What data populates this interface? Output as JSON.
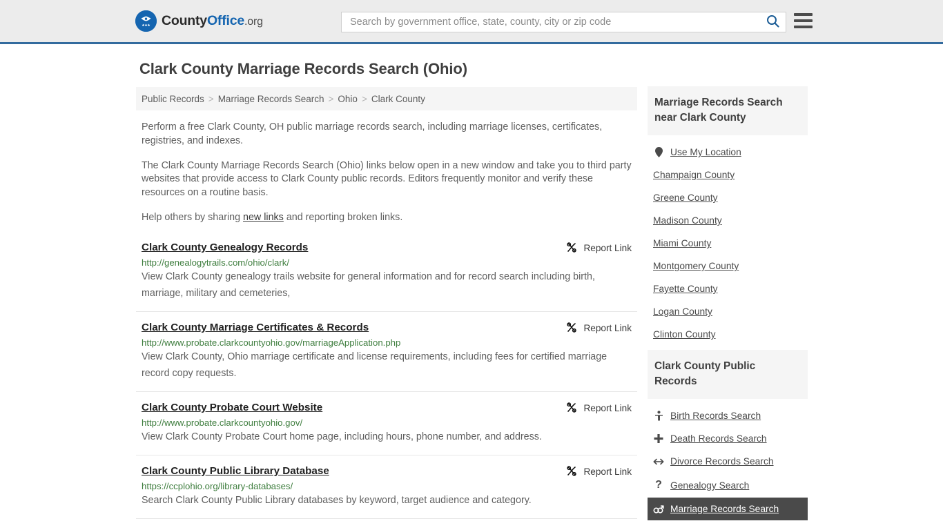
{
  "header": {
    "logo": {
      "part1": "County",
      "part2": "Office",
      "part3": ".org",
      "icon": "eagle-seal-icon"
    },
    "search": {
      "placeholder": "Search by government office, state, county, city or zip code",
      "value": "",
      "icon": "search-icon"
    },
    "menu_icon": "hamburger-menu-icon"
  },
  "page": {
    "title": "Clark County Marriage Records Search (Ohio)"
  },
  "breadcrumb": {
    "separator": ">",
    "items": [
      {
        "label": "Public Records"
      },
      {
        "label": "Marriage Records Search"
      },
      {
        "label": "Ohio"
      },
      {
        "label": "Clark County"
      }
    ]
  },
  "intro": {
    "p1": "Perform a free Clark County, OH public marriage records search, including marriage licenses, certificates, registries, and indexes.",
    "p2": "The Clark County Marriage Records Search (Ohio) links below open in a new window and take you to third party websites that provide access to Clark County public records. Editors frequently monitor and verify these resources on a routine basis.",
    "p3_before": "Help others by sharing ",
    "p3_link": "new links",
    "p3_after": " and reporting broken links."
  },
  "results": {
    "report_label": "Report Link",
    "report_icon": "broken-link-icon",
    "items": [
      {
        "title": "Clark County Genealogy Records",
        "url": "http://genealogytrails.com/ohio/clark/",
        "description": "View Clark County genealogy trails website for general information and for record search including birth, marriage, military and cemeteries,"
      },
      {
        "title": "Clark County Marriage Certificates & Records",
        "url": "http://www.probate.clarkcountyohio.gov/marriageApplication.php",
        "description": "View Clark County, Ohio marriage certificate and license requirements, including fees for certified marriage record copy requests."
      },
      {
        "title": "Clark County Probate Court Website",
        "url": "http://www.probate.clarkcountyohio.gov/",
        "description": "View Clark County Probate Court home page, including hours, phone number, and address."
      },
      {
        "title": "Clark County Public Library Database",
        "url": "https://ccplohio.org/library-databases/",
        "description": "Search Clark County Public Library databases by keyword, target audience and category."
      }
    ]
  },
  "sidebar": {
    "nearby": {
      "heading": "Marriage Records Search near Clark County",
      "items": [
        {
          "label": "Use My Location",
          "icon": "map-pin-icon",
          "has_icon": true
        },
        {
          "label": "Champaign County",
          "icon": "",
          "has_icon": false
        },
        {
          "label": "Greene County",
          "icon": "",
          "has_icon": false
        },
        {
          "label": "Madison County",
          "icon": "",
          "has_icon": false
        },
        {
          "label": "Miami County",
          "icon": "",
          "has_icon": false
        },
        {
          "label": "Montgomery County",
          "icon": "",
          "has_icon": false
        },
        {
          "label": "Fayette County",
          "icon": "",
          "has_icon": false
        },
        {
          "label": "Logan County",
          "icon": "",
          "has_icon": false
        },
        {
          "label": "Clinton County",
          "icon": "",
          "has_icon": false
        }
      ]
    },
    "public_records": {
      "heading": "Clark County Public Records",
      "items": [
        {
          "label": "Birth Records Search",
          "icon": "baby-icon",
          "glyph": "Ŧ",
          "active": false
        },
        {
          "label": "Death Records Search",
          "icon": "cross-icon",
          "glyph": "✚",
          "active": false
        },
        {
          "label": "Divorce Records Search",
          "icon": "left-right-arrow-icon",
          "glyph": "↔",
          "active": false
        },
        {
          "label": "Genealogy Search",
          "icon": "question-mark-icon",
          "glyph": "?",
          "active": false
        },
        {
          "label": "Marriage Records Search",
          "icon": "male-female-icon",
          "glyph": "⚥",
          "active": true
        }
      ]
    }
  },
  "colors": {
    "brand_blue": "#1565b0",
    "header_border": "#336b9e",
    "header_bg": "#ececec",
    "url_green": "#3f7e3f",
    "active_bg": "#4a4a4a",
    "panel_bg": "#f5f5f5"
  }
}
